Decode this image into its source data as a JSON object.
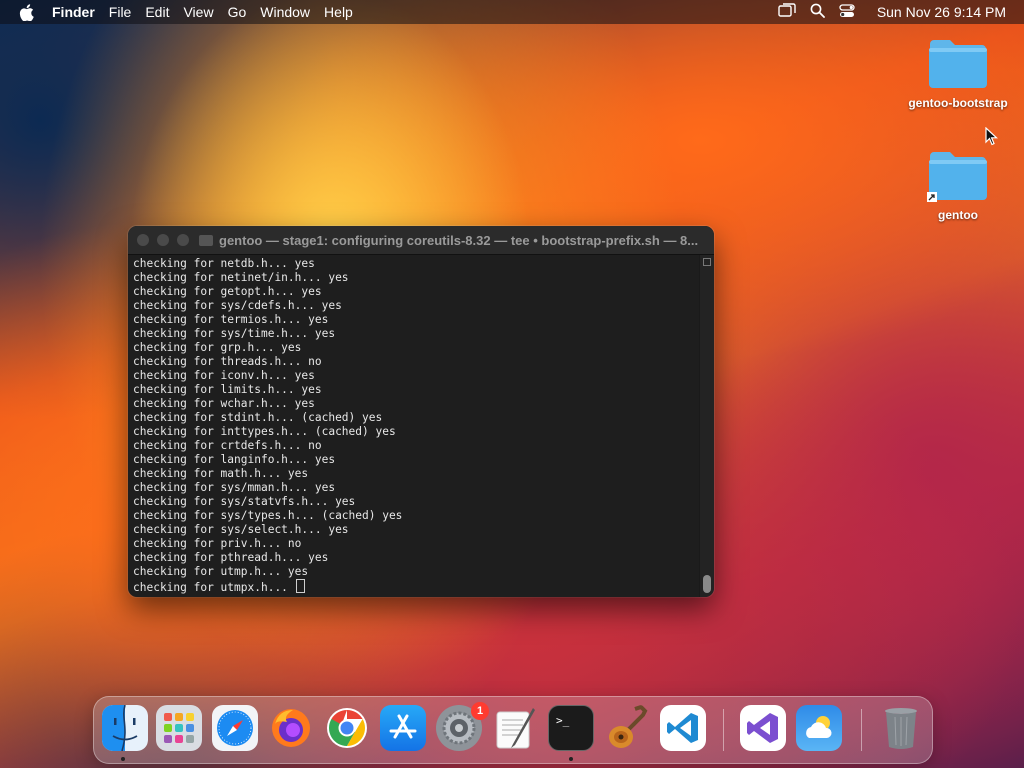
{
  "menubar": {
    "app_name": "Finder",
    "menus": [
      "File",
      "Edit",
      "View",
      "Go",
      "Window",
      "Help"
    ],
    "clock": "Sun Nov 26  9:14 PM",
    "status_icons": [
      "screen-mirroring-icon",
      "spotlight-search-icon",
      "control-center-icon"
    ]
  },
  "desktop": {
    "icons": [
      {
        "label": "gentoo-bootstrap",
        "icon": "folder-icon"
      },
      {
        "label": "gentoo",
        "icon": "folder-alias-icon"
      }
    ]
  },
  "terminal": {
    "title": "gentoo — stage1: configuring coreutils-8.32 — tee • bootstrap-prefix.sh — 8...",
    "lines": [
      "checking for netdb.h... yes",
      "checking for netinet/in.h... yes",
      "checking for getopt.h... yes",
      "checking for sys/cdefs.h... yes",
      "checking for termios.h... yes",
      "checking for sys/time.h... yes",
      "checking for grp.h... yes",
      "checking for threads.h... no",
      "checking for iconv.h... yes",
      "checking for limits.h... yes",
      "checking for wchar.h... yes",
      "checking for stdint.h... (cached) yes",
      "checking for inttypes.h... (cached) yes",
      "checking for crtdefs.h... no",
      "checking for langinfo.h... yes",
      "checking for math.h... yes",
      "checking for sys/mman.h... yes",
      "checking for sys/statvfs.h... yes",
      "checking for sys/types.h... (cached) yes",
      "checking for sys/select.h... yes",
      "checking for priv.h... no",
      "checking for pthread.h... yes",
      "checking for utmp.h... yes",
      "checking for utmpx.h... "
    ]
  },
  "dock": {
    "apps": [
      {
        "name": "Finder",
        "icon": "finder-icon",
        "running": true
      },
      {
        "name": "Launchpad",
        "icon": "launchpad-icon",
        "running": false
      },
      {
        "name": "Safari",
        "icon": "safari-icon",
        "running": false
      },
      {
        "name": "Firefox",
        "icon": "firefox-icon",
        "running": false
      },
      {
        "name": "Google Chrome",
        "icon": "chrome-icon",
        "running": false
      },
      {
        "name": "App Store",
        "icon": "app-store-icon",
        "running": false
      },
      {
        "name": "System Settings",
        "icon": "system-settings-icon",
        "running": false,
        "badge": "1"
      },
      {
        "name": "TextEdit",
        "icon": "textedit-icon",
        "running": false
      },
      {
        "name": "Terminal",
        "icon": "terminal-icon",
        "running": true
      },
      {
        "name": "GarageBand",
        "icon": "guitar-icon",
        "running": false
      },
      {
        "name": "Visual Studio Code",
        "icon": "vscode-icon",
        "running": false
      },
      {
        "name": "Visual Studio",
        "icon": "visual-studio-icon",
        "running": false
      },
      {
        "name": "Weather",
        "icon": "weather-icon",
        "running": false
      },
      {
        "name": "Trash",
        "icon": "trash-icon",
        "running": false
      }
    ]
  }
}
